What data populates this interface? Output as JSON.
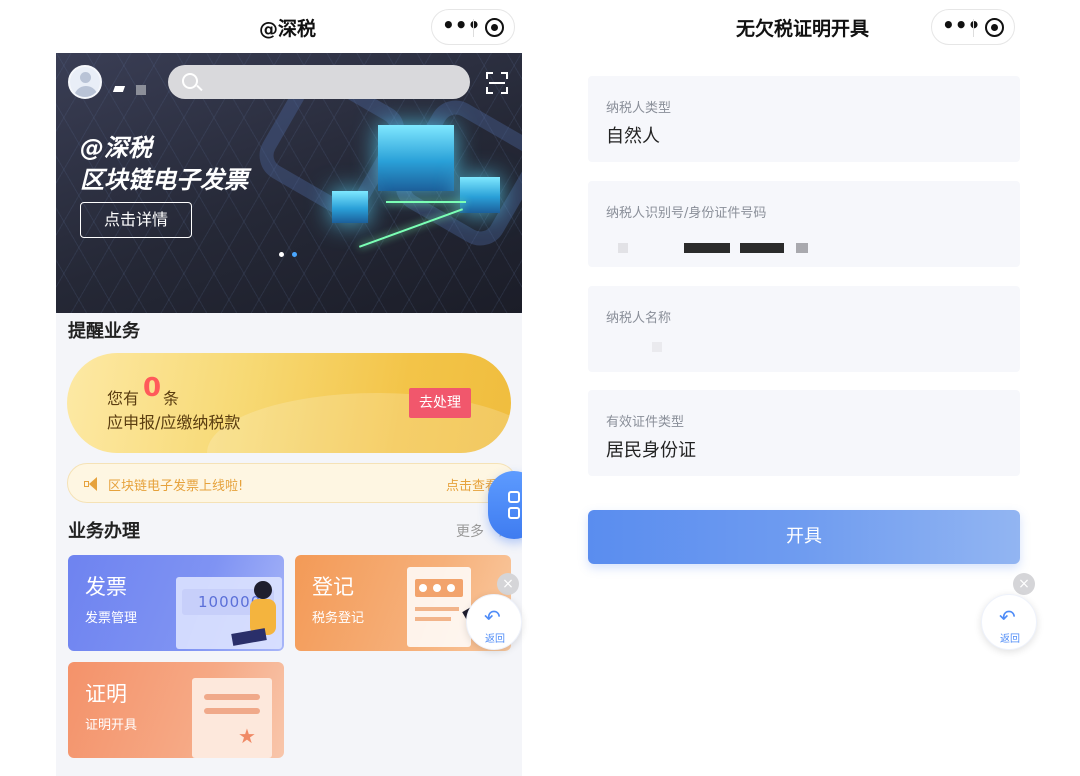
{
  "left": {
    "nav_title": "@深税",
    "banner": {
      "line1": "@深税",
      "line2": "区块链电子发票",
      "button": "点击详情"
    },
    "remind": {
      "section_title": "提醒业务",
      "you_have": "您有",
      "count": "0",
      "unit": "条",
      "line2": "应申报/应缴纳税款",
      "button": "去处理"
    },
    "notice": {
      "text": "区块链电子发票上线啦!",
      "link": "点击查看"
    },
    "business": {
      "section_title": "业务办理",
      "more": "更多",
      "cards": [
        {
          "title": "发票",
          "subtitle": "发票管理",
          "illustration_text": "100000"
        },
        {
          "title": "登记",
          "subtitle": "税务登记"
        },
        {
          "title": "证明",
          "subtitle": "证明开具"
        }
      ]
    },
    "back_label": "返回",
    "close_symbol": "×"
  },
  "right": {
    "nav_title": "无欠税证明开具",
    "fields": [
      {
        "label": "纳税人类型",
        "value": "自然人"
      },
      {
        "label": "纳税人识别号/身份证件号码",
        "value": ""
      },
      {
        "label": "纳税人名称",
        "value": ""
      },
      {
        "label": "有效证件类型",
        "value": "居民身份证"
      }
    ],
    "submit": "开具",
    "back_label": "返回",
    "close_symbol": "×"
  },
  "capsule": {
    "menu_glyph": "•••"
  },
  "colors": {
    "accent_blue": "#5a8def",
    "alert_red": "#f1576c",
    "notice_orange": "#e6a23c",
    "count_red": "#ff5a5a"
  }
}
